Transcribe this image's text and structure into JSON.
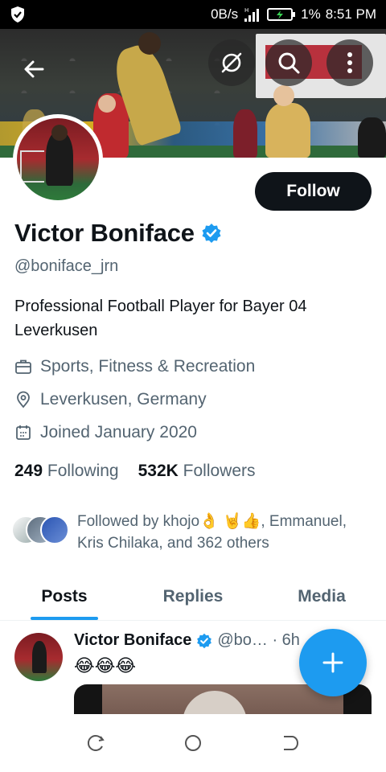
{
  "status_bar": {
    "net_speed": "0B/s",
    "battery_percent": "1%",
    "time": "8:51 PM",
    "icons": [
      "shield-icon",
      "signal-icon",
      "battery-charging-icon"
    ]
  },
  "header": {
    "back_icon": "arrow-left-icon",
    "action_icons": [
      "grok-icon",
      "search-icon",
      "more-vertical-icon"
    ]
  },
  "profile": {
    "follow_label": "Follow",
    "name": "Victor Boniface",
    "verified": true,
    "handle": "@boniface_jrn",
    "bio": "Professional Football Player for Bayer 04 Leverkusen",
    "category": "Sports, Fitness & Recreation",
    "location": "Leverkusen, Germany",
    "joined": "Joined January 2020",
    "following_count": "249",
    "following_label": "Following",
    "followers_count": "532K",
    "followers_label": "Followers",
    "followed_by": "Followed by khojo👌 🤘👍, Emmanuel, Kris Chilaka, and 362 others"
  },
  "tabs": [
    {
      "label": "Posts",
      "active": true
    },
    {
      "label": "Replies",
      "active": false
    },
    {
      "label": "Media",
      "active": false
    }
  ],
  "tweet": {
    "name": "Victor Boniface",
    "handle_time": "@bo… · 6h",
    "text": "😂😂😂"
  },
  "colors": {
    "accent": "#1d9bf0",
    "primary_text": "#0f1419",
    "secondary_text": "#536471",
    "follow_button": "#0f1419"
  },
  "nav_bar": {
    "icons": [
      "recent-apps-icon",
      "home-icon",
      "back-icon"
    ]
  }
}
